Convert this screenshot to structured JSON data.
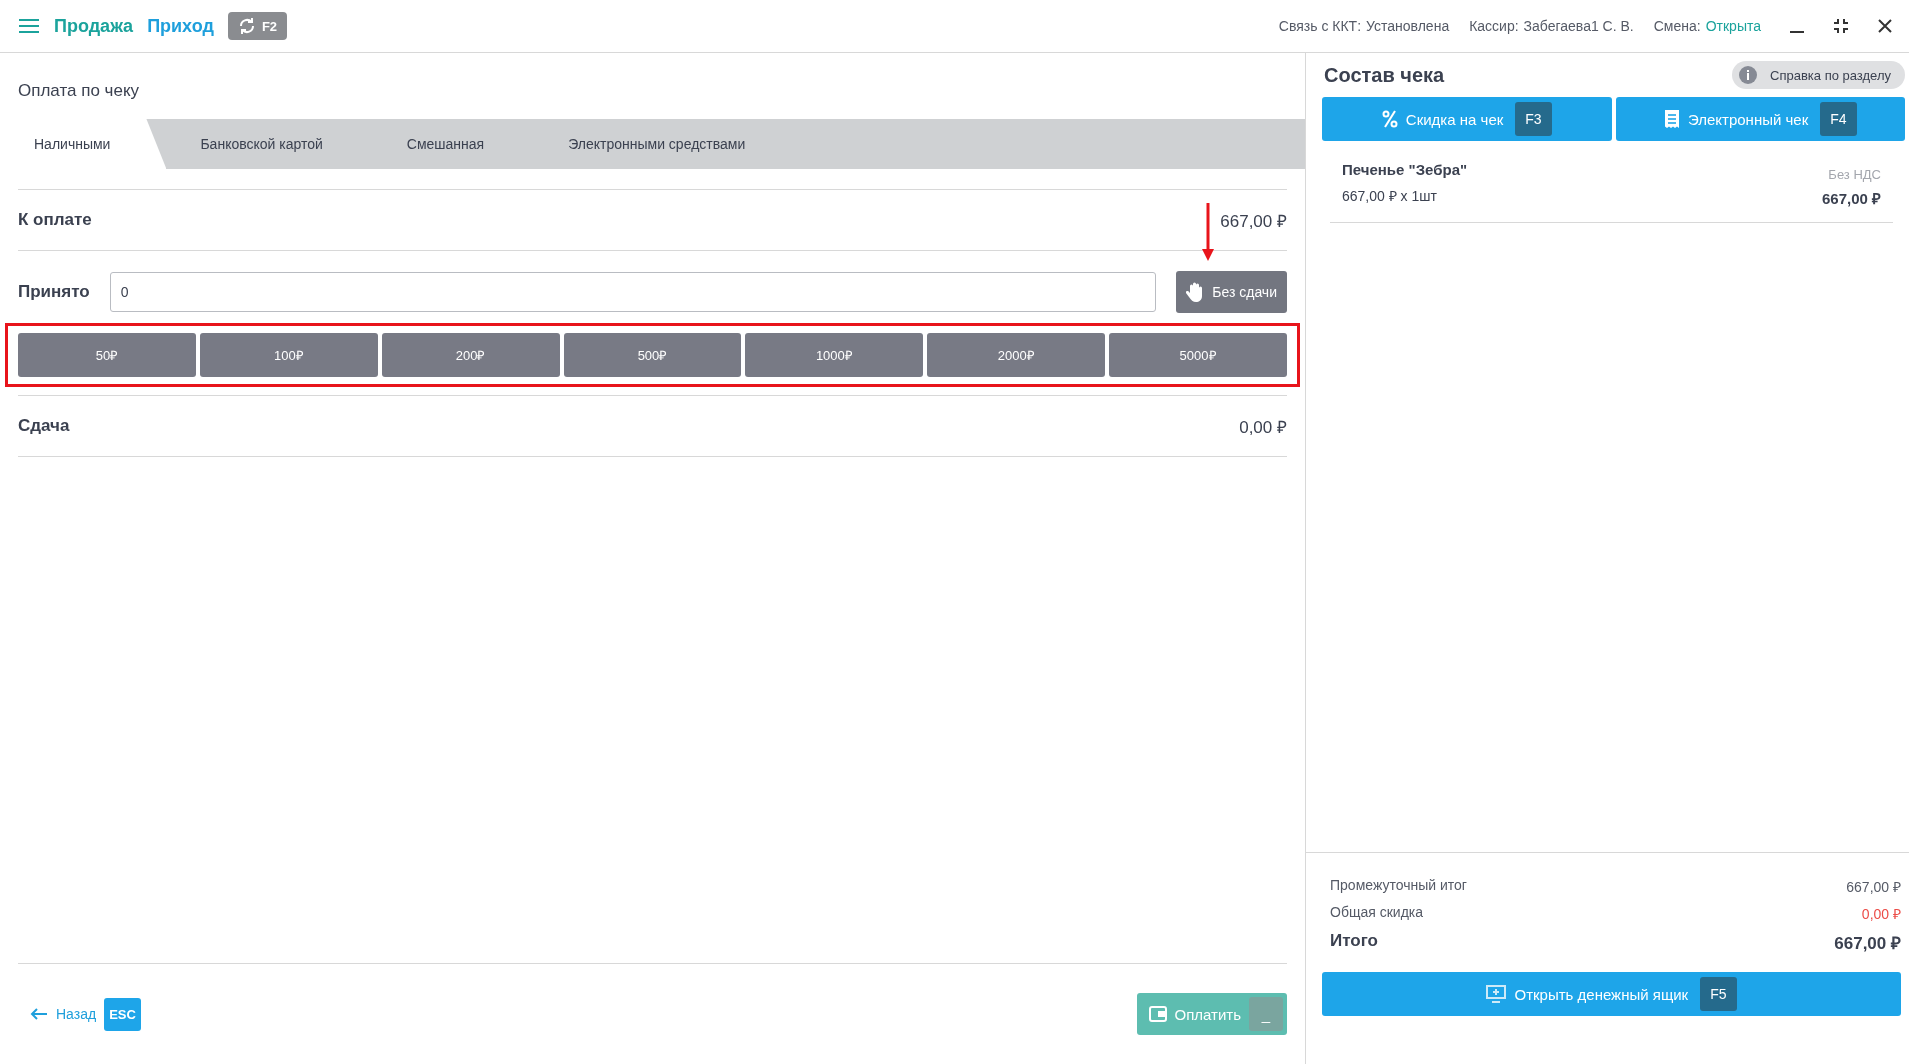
{
  "header": {
    "title": "Продажа",
    "subtitle": "Приход",
    "sync_key": "F2",
    "status": [
      {
        "label": "Связь с ККТ:",
        "value": "Установлена",
        "highlight": false
      },
      {
        "label": "Кассир:",
        "value": "Забегаева1 С. В.",
        "highlight": false
      },
      {
        "label": "Смена:",
        "value": "Открыта",
        "highlight": true
      }
    ]
  },
  "payment": {
    "title": "Оплата по чеку",
    "tabs": [
      {
        "label": "Наличными",
        "selected": true
      },
      {
        "label": "Банковской картой",
        "selected": false
      },
      {
        "label": "Смешанная",
        "selected": false
      },
      {
        "label": "Электронными средствами",
        "selected": false
      }
    ],
    "due": {
      "label": "К оплате",
      "value": "667,00 ₽"
    },
    "received": {
      "label": "Принято",
      "value": "0",
      "no_change_button": "Без сдачи"
    },
    "denominations": [
      "50₽",
      "100₽",
      "200₽",
      "500₽",
      "1000₽",
      "2000₽",
      "5000₽"
    ],
    "change": {
      "label": "Сдача",
      "value": "0,00 ₽"
    },
    "back": {
      "label": "Назад",
      "key": "ESC"
    },
    "pay": {
      "label": "Оплатить",
      "key": "_"
    }
  },
  "annotations": {
    "arrow": true,
    "highlight_box": true
  },
  "receipt": {
    "title": "Состав чека",
    "help": "Справка по разделу",
    "buttons": [
      {
        "kind": "discount",
        "label": "Скидка на чек",
        "key": "F3"
      },
      {
        "kind": "ereceipt",
        "label": "Электронный чек",
        "key": "F4"
      }
    ],
    "items": [
      {
        "name": "Печенье \"Зебра\"",
        "quantity": "667,00 ₽ x 1шт",
        "vat": "Без НДС",
        "total": "667,00 ₽"
      }
    ],
    "subtotal": {
      "label": "Промежуточный итог",
      "value": "667,00 ₽"
    },
    "discount": {
      "label": "Общая скидка",
      "value": "0,00 ₽"
    },
    "total": {
      "label": "Итого",
      "value": "667,00 ₽"
    },
    "drawer": {
      "label": "Открыть денежный ящик",
      "key": "F5"
    }
  }
}
